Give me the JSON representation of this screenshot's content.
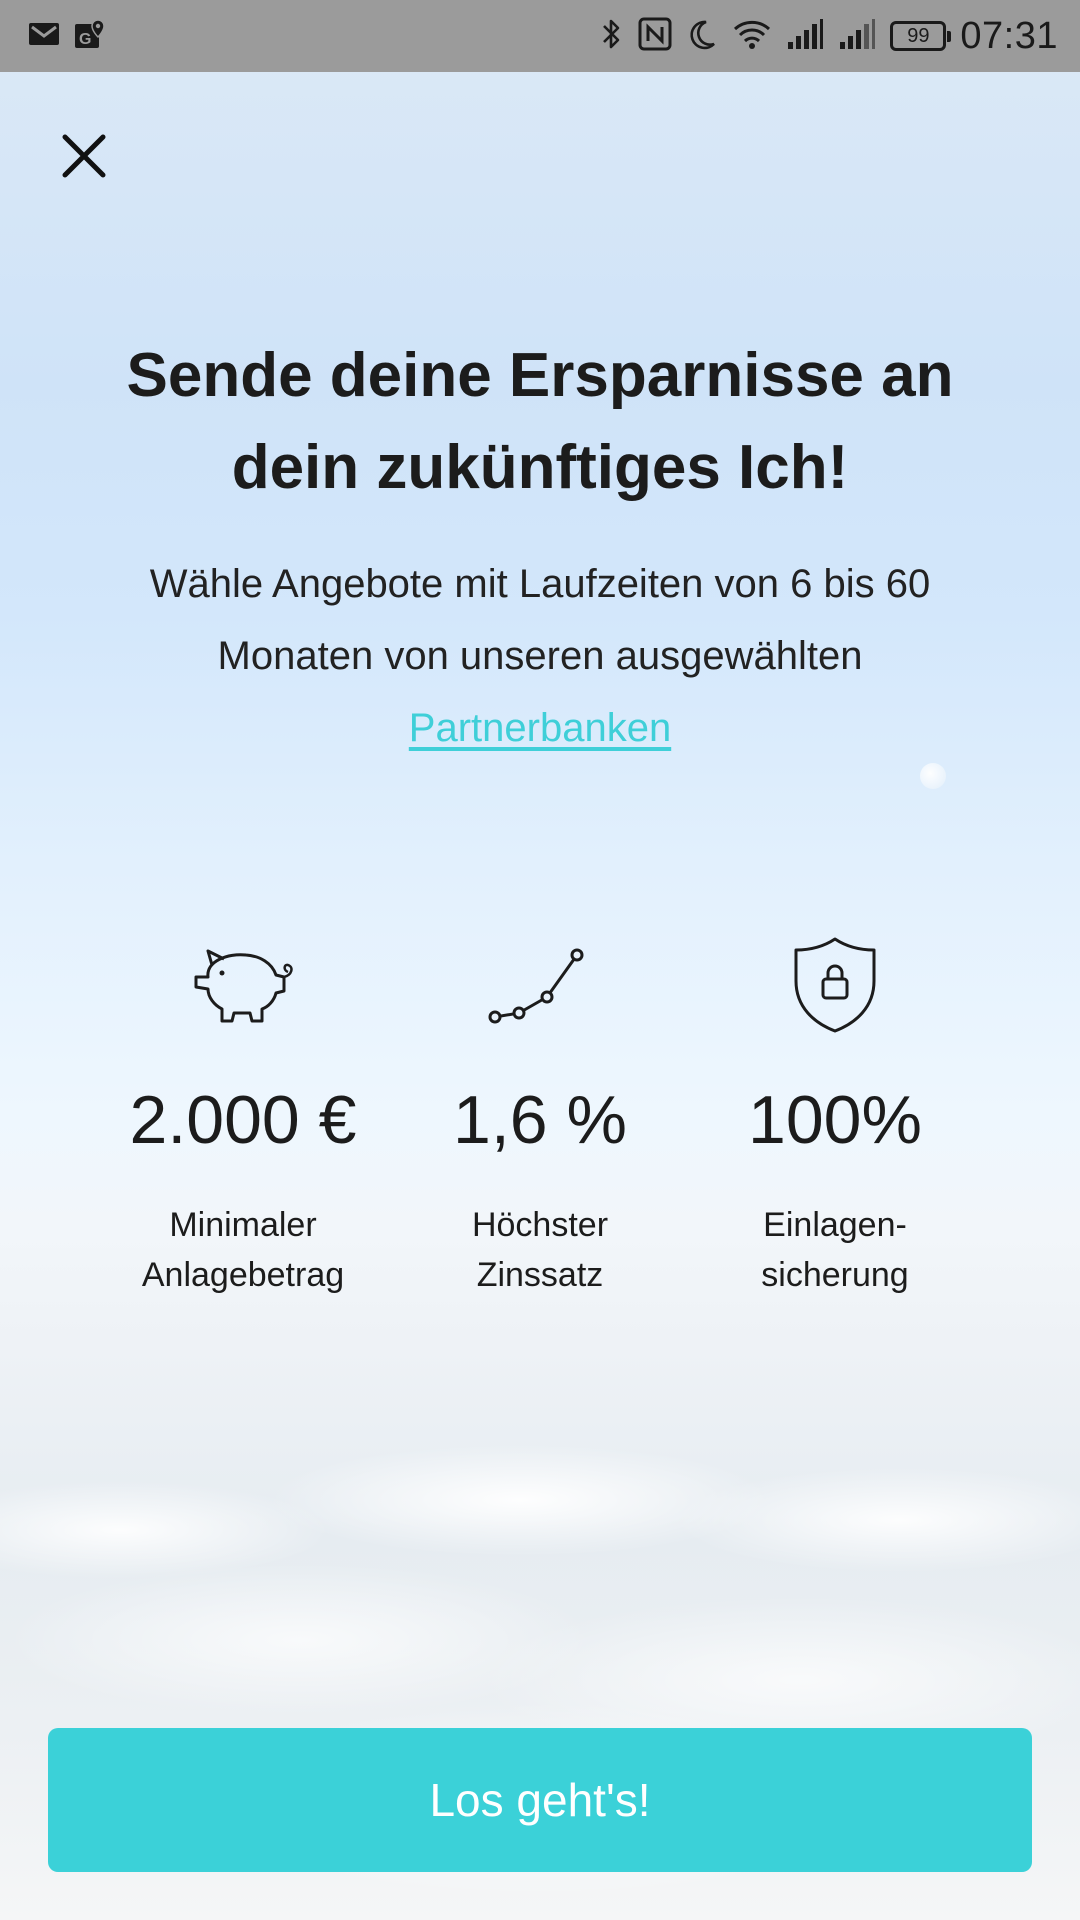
{
  "status_bar": {
    "time": "07:31",
    "battery_level": "99",
    "left_icons": [
      "gmail-icon",
      "maps-icon"
    ],
    "right_icons": [
      "bluetooth-icon",
      "nfc-icon",
      "do-not-disturb-icon",
      "wifi-icon",
      "signal-icon",
      "signal-icon-2",
      "battery-icon"
    ]
  },
  "header": {
    "close_icon": "close-icon"
  },
  "main": {
    "headline_line1": "Sende deine Ersparnisse an",
    "headline_line2": "dein zukünftiges Ich!",
    "subtitle_line1": "Wähle Angebote mit Laufzeiten von 6 bis 60",
    "subtitle_line2": "Monaten von unseren ausgewählten",
    "partner_link": "Partnerbanken"
  },
  "features": [
    {
      "icon": "piggy-bank-icon",
      "value": "2.000 €",
      "label_line1": "Minimaler",
      "label_line2": "Anlagebetrag"
    },
    {
      "icon": "trend-line-icon",
      "value": "1,6 %",
      "label_line1": "Höchster",
      "label_line2": "Zinssatz"
    },
    {
      "icon": "shield-lock-icon",
      "value": "100%",
      "label_line1": "Einlagen-",
      "label_line2": "sicherung"
    }
  ],
  "cta": {
    "label": "Los geht's!"
  },
  "colors": {
    "accent": "#3bd1d8",
    "link": "#3fcfd8",
    "text": "#1c1c1c",
    "status_bar": "#9b9b9b"
  }
}
